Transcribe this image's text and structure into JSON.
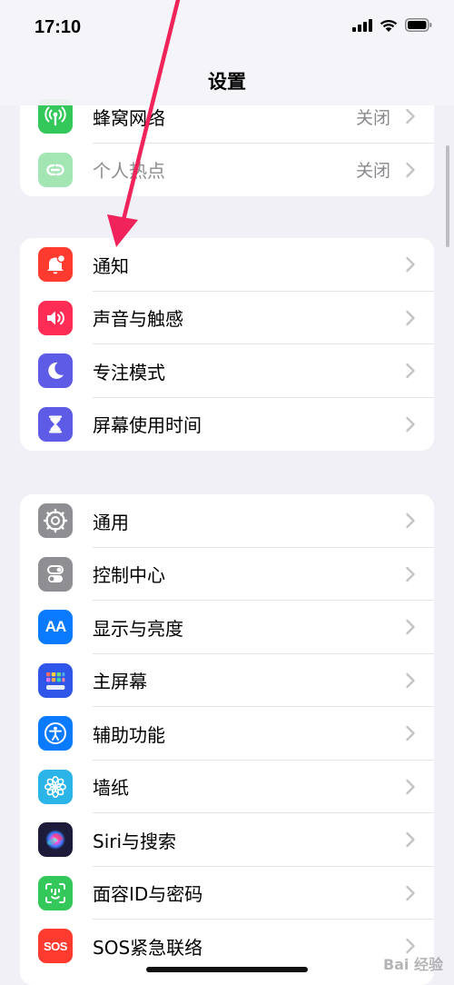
{
  "status": {
    "time": "17:10"
  },
  "nav": {
    "title": "设置"
  },
  "groups": [
    {
      "items": [
        {
          "label": "蜂窝网络",
          "value": "关闭",
          "icon": "antenna-icon",
          "color": "#34c759"
        },
        {
          "label": "个人热点",
          "value": "关闭",
          "icon": "link-icon",
          "color": "#34c759"
        }
      ]
    },
    {
      "items": [
        {
          "label": "通知",
          "icon": "bell-icon",
          "color": "#ff3b30"
        },
        {
          "label": "声音与触感",
          "icon": "speaker-icon",
          "color": "#ff2d55"
        },
        {
          "label": "专注模式",
          "icon": "moon-icon",
          "color": "#5e5ce6"
        },
        {
          "label": "屏幕使用时间",
          "icon": "hourglass-icon",
          "color": "#5e5ce6"
        }
      ]
    },
    {
      "items": [
        {
          "label": "通用",
          "icon": "gear-icon",
          "color": "#8e8e93"
        },
        {
          "label": "控制中心",
          "icon": "toggles-icon",
          "color": "#8e8e93"
        },
        {
          "label": "显示与亮度",
          "icon": "text-size-icon",
          "color": "#0a7aff",
          "glyph": "AA"
        },
        {
          "label": "主屏幕",
          "icon": "app-grid-icon",
          "color": "#2f56e8"
        },
        {
          "label": "辅助功能",
          "icon": "accessibility-icon",
          "color": "#0a7aff"
        },
        {
          "label": "墙纸",
          "icon": "flower-icon",
          "color": "#2ab4e8"
        },
        {
          "label": "Siri与搜索",
          "icon": "siri-icon",
          "color": "#1c1c3a"
        },
        {
          "label": "面容ID与密码",
          "icon": "face-id-icon",
          "color": "#34c759"
        },
        {
          "label": "SOS紧急联络",
          "icon": "sos-icon",
          "color": "#ff3b30",
          "glyph": "SOS"
        }
      ]
    }
  ],
  "watermark": "Bai 经验"
}
